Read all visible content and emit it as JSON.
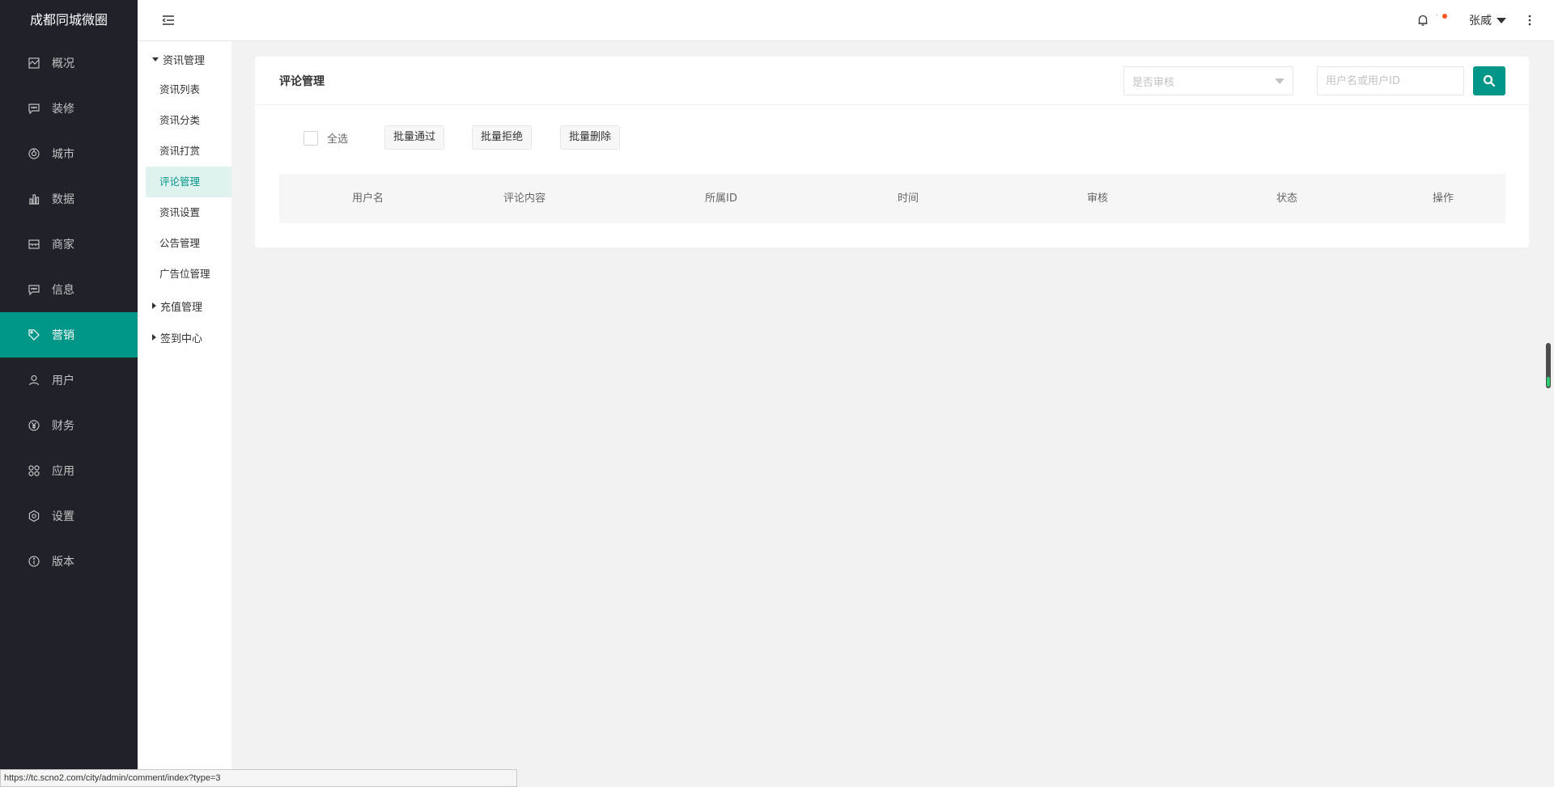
{
  "app": {
    "title": "成都同城微圈"
  },
  "sidebar": {
    "items": [
      {
        "label": "概况",
        "icon": "dashboard-icon"
      },
      {
        "label": "装修",
        "icon": "message-icon"
      },
      {
        "label": "城市",
        "icon": "city-icon"
      },
      {
        "label": "数据",
        "icon": "chart-icon"
      },
      {
        "label": "商家",
        "icon": "store-icon"
      },
      {
        "label": "信息",
        "icon": "message-icon"
      },
      {
        "label": "营销",
        "icon": "tag-icon",
        "active": true
      },
      {
        "label": "用户",
        "icon": "user-icon"
      },
      {
        "label": "财务",
        "icon": "yen-icon"
      },
      {
        "label": "应用",
        "icon": "apps-icon"
      },
      {
        "label": "设置",
        "icon": "gear-icon"
      },
      {
        "label": "版本",
        "icon": "info-icon"
      }
    ]
  },
  "header": {
    "user": "张威",
    "accent": "#009688",
    "notify_dot_color": "#ff5722"
  },
  "submenu": {
    "group1": "资讯管理",
    "items": [
      "资讯列表",
      "资讯分类",
      "资讯打赏",
      "评论管理",
      "资讯设置",
      "公告管理",
      "广告位管理"
    ],
    "active_item": "评论管理",
    "group2": "充值管理",
    "group3": "签到中心"
  },
  "main": {
    "title": "评论管理",
    "filter": {
      "selected": "是否审核"
    },
    "search": {
      "placeholder": "用户名或用户ID"
    },
    "select_all": "全选",
    "buttons": {
      "approve": "批量通过",
      "reject": "批量拒绝",
      "delete": "批量删除"
    },
    "table": {
      "columns": [
        "用户名",
        "评论内容",
        "所属ID",
        "时间",
        "审核",
        "状态",
        "操作"
      ]
    }
  },
  "statusbar": {
    "url": "https://tc.scno2.com/city/admin/comment/index?type=3"
  }
}
